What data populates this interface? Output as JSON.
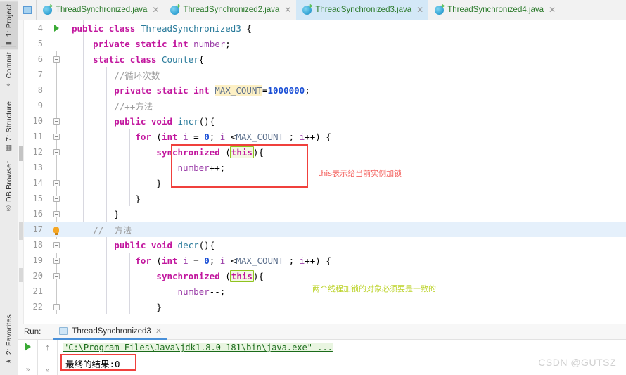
{
  "sidebar": {
    "items": [
      {
        "label": "1: Project",
        "icon": "project-icon",
        "active": true
      },
      {
        "label": "Commit",
        "icon": "commit-icon",
        "active": false
      },
      {
        "label": "7: Structure",
        "icon": "structure-icon",
        "active": false
      },
      {
        "label": "DB Browser",
        "icon": "db-browser-icon",
        "active": false
      },
      {
        "label": "2: Favorites",
        "icon": "star-icon",
        "active": false
      }
    ]
  },
  "tabs": [
    {
      "label": "ThreadSynchronized.java",
      "active": false
    },
    {
      "label": "ThreadSynchronized2.java",
      "active": false
    },
    {
      "label": "ThreadSynchronized3.java",
      "active": true
    },
    {
      "label": "ThreadSynchronized4.java",
      "active": false
    }
  ],
  "editor": {
    "lines": [
      {
        "num": "4",
        "marker": "run-arrow",
        "text": "public class ThreadSynchronized3 {"
      },
      {
        "num": "5",
        "marker": "none",
        "text": "    private static int number;"
      },
      {
        "num": "6",
        "marker": "fold",
        "text": "    static class Counter{"
      },
      {
        "num": "7",
        "marker": "none",
        "text": "        //循环次数"
      },
      {
        "num": "8",
        "marker": "none",
        "text": "        private static int MAX_COUNT=1000000;"
      },
      {
        "num": "9",
        "marker": "none",
        "text": "        //++方法"
      },
      {
        "num": "10",
        "marker": "fold",
        "text": "        public void incr(){"
      },
      {
        "num": "11",
        "marker": "fold",
        "text": "            for (int i = 0; i <MAX_COUNT ; i++) {"
      },
      {
        "num": "12",
        "marker": "fold",
        "text": "                synchronized (this){"
      },
      {
        "num": "13",
        "marker": "none",
        "text": "                    number++;"
      },
      {
        "num": "14",
        "marker": "fold",
        "text": "                }"
      },
      {
        "num": "15",
        "marker": "fold",
        "text": "            }"
      },
      {
        "num": "16",
        "marker": "fold",
        "text": "        }"
      },
      {
        "num": "17",
        "marker": "bulb",
        "text": "    //--方法",
        "highlighted": true
      },
      {
        "num": "18",
        "marker": "fold",
        "text": "        public void decr(){"
      },
      {
        "num": "19",
        "marker": "fold",
        "text": "            for (int i = 0; i <MAX_COUNT ; i++) {"
      },
      {
        "num": "20",
        "marker": "fold",
        "text": "                synchronized (this){"
      },
      {
        "num": "21",
        "marker": "none",
        "text": "                    number--;"
      },
      {
        "num": "22",
        "marker": "fold",
        "text": "                }"
      }
    ]
  },
  "annotations": [
    {
      "text": "this表示给当前实例加锁",
      "color": "#f4615e"
    },
    {
      "text": "两个线程加锁的对象必须要是一致的",
      "color": "#bcd32a"
    }
  ],
  "run_panel": {
    "label": "Run:",
    "tab_label": "ThreadSynchronized3",
    "console_line1": "\"C:\\Program Files\\Java\\jdk1.8.0_181\\bin\\java.exe\" ...",
    "console_line2": "最终的结果:0"
  },
  "watermark": "CSDN @GUTSZ",
  "colors": {
    "accent_blue": "#4a90d9",
    "tab_active_bg": "#d3e8f7",
    "annotation_red": "#f0403c",
    "annotation_green": "#8fc31f",
    "keyword": "#c2179e",
    "class_name": "#2a7b9b",
    "number": "#1a4fd6",
    "comment": "#9a9a9a",
    "highlight_yellow": "#fdf0c4",
    "line_highlight": "#e5f0fb"
  }
}
